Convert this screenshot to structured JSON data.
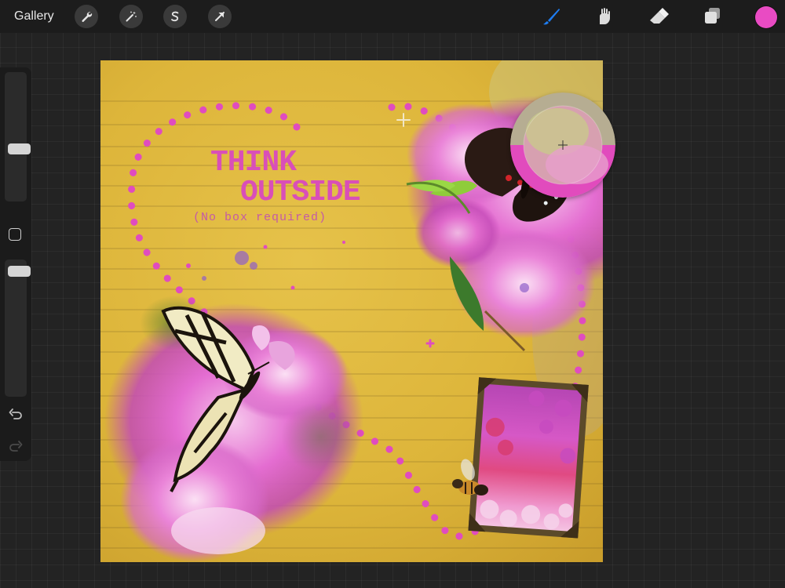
{
  "topbar": {
    "gallery_label": "Gallery",
    "left_tools": [
      "wrench-icon",
      "magic-wand-icon",
      "selection-icon",
      "transform-arrow-icon"
    ],
    "right_tools": [
      "brush-icon",
      "smudge-icon",
      "eraser-icon",
      "layers-icon"
    ],
    "active_tool": "brush-icon",
    "current_color": "#e94bc3"
  },
  "sidebar": {
    "brush_size_level": 0.4,
    "opacity_level": 0.95
  },
  "canvas": {
    "title_line1": "THINK",
    "title_line2": "OUTSIDE",
    "subtitle": "(No box required)"
  },
  "colors": {
    "accent_pink": "#d94fb8",
    "paper_yellow": "#ddb53a",
    "tool_blue": "#1e7cf0"
  }
}
